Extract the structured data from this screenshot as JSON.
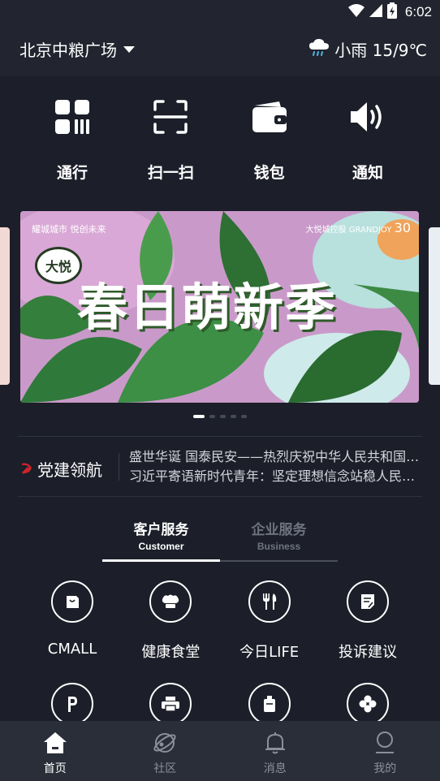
{
  "status_bar": {
    "time": "6:02"
  },
  "header": {
    "location": "北京中粮广场",
    "weather": "小雨 15/9℃",
    "icons": [
      "chevron-down-icon",
      "rain-cloud-icon"
    ]
  },
  "quick_actions": [
    {
      "label": "通行",
      "icon": "qr-grid-icon"
    },
    {
      "label": "扫一扫",
      "icon": "scan-icon"
    },
    {
      "label": "钱包",
      "icon": "wallet-icon"
    },
    {
      "label": "通知",
      "icon": "speaker-icon"
    }
  ],
  "banner": {
    "title": "春日萌新季",
    "badge": "大悦",
    "top_left_text": "耀城城市 悦创未来",
    "top_right_text": "大悦城控股 GRANDJOY",
    "top_right_number": "30",
    "pages": 5,
    "active_page": 1
  },
  "party": {
    "label": "党建领航",
    "news": [
      "盛世华诞 国泰民安——热烈庆祝中华人民共和国成立",
      "习近平寄语新时代青年：坚定理想信念站稳人民立场"
    ]
  },
  "tabs": [
    {
      "cn": "客户服务",
      "en": "Customer"
    },
    {
      "cn": "企业服务",
      "en": "Business"
    }
  ],
  "services": [
    {
      "label": "CMALL",
      "icon": "shopping-bag-icon"
    },
    {
      "label": "健康食堂",
      "icon": "chef-hat-icon"
    },
    {
      "label": "今日LIFE",
      "icon": "fork-knife-icon"
    },
    {
      "label": "投诉建议",
      "icon": "feedback-edit-icon"
    },
    {
      "label": "",
      "icon": "parking-icon"
    },
    {
      "label": "",
      "icon": "printer-icon"
    },
    {
      "label": "",
      "icon": "bag-icon"
    },
    {
      "label": "",
      "icon": "clover-icon"
    }
  ],
  "bottom_nav": [
    {
      "label": "首页",
      "icon": "home-icon",
      "active": true
    },
    {
      "label": "社区",
      "icon": "planet-icon",
      "active": false
    },
    {
      "label": "消息",
      "icon": "bell-icon",
      "active": false
    },
    {
      "label": "我的",
      "icon": "user-icon",
      "active": false
    }
  ],
  "colors": {
    "background": "#1c1f29",
    "header": "#22252f",
    "nav": "#2a2e38",
    "party_red": "#d0242b"
  }
}
